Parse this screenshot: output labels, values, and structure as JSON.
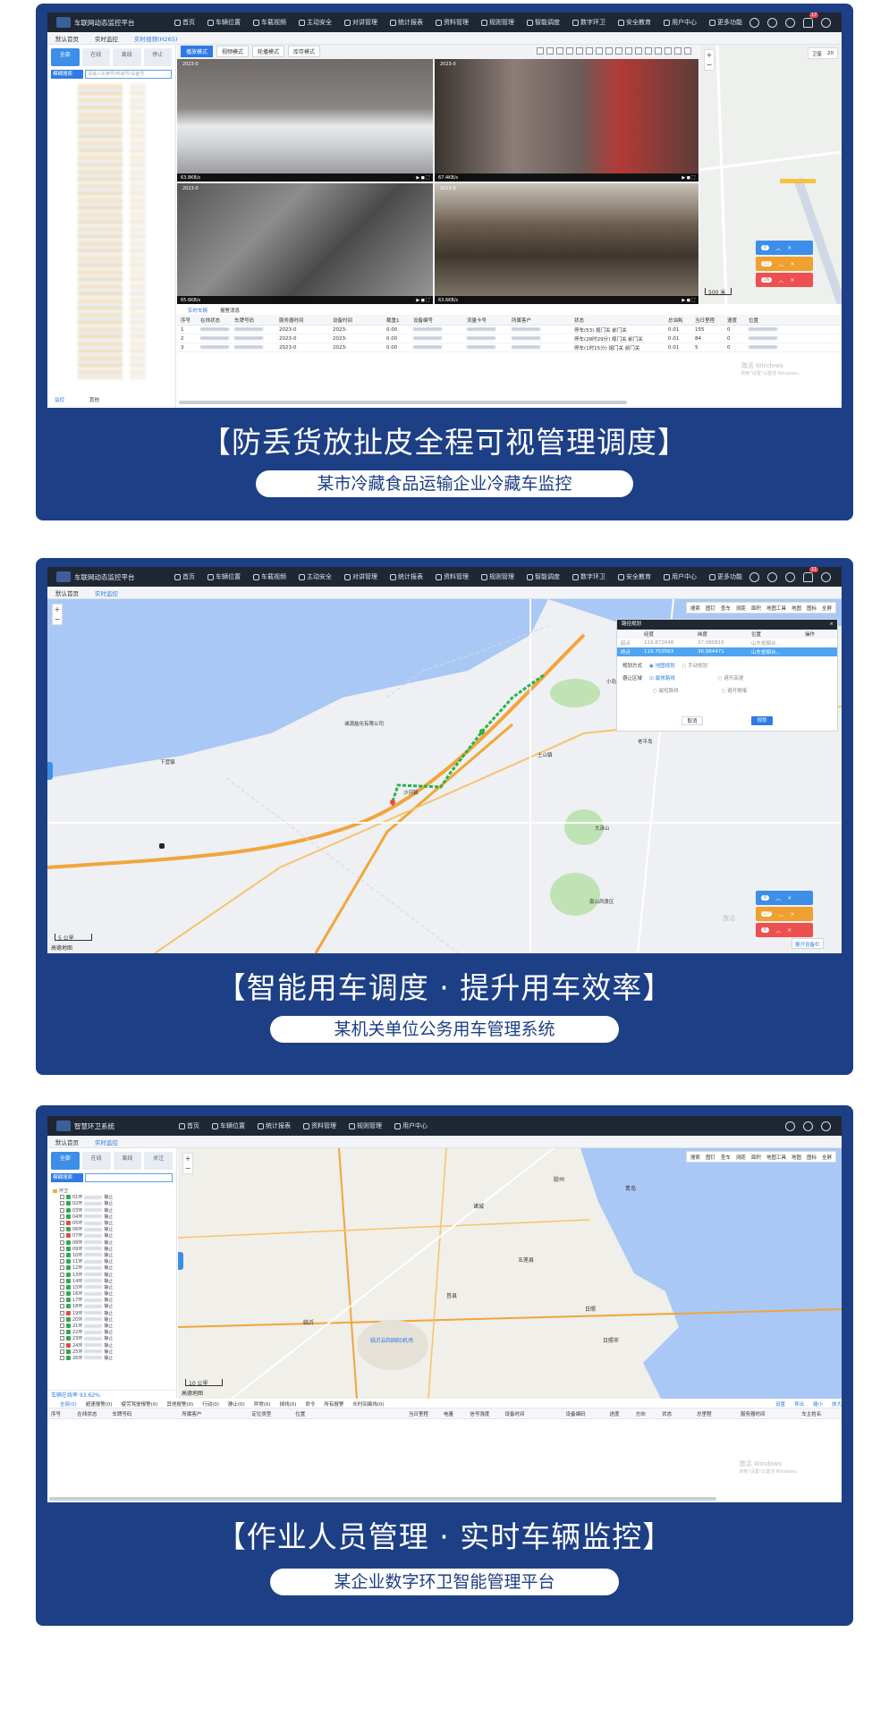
{
  "colors": {
    "card_bg": "#1d3f86",
    "app_bar": "#1f2733",
    "accent": "#2e7ae6",
    "track_green": "#28b44a",
    "road_orange": "#f3a53a",
    "sea_blue": "#a9c8f5"
  },
  "panel1": {
    "app_title": "车联网动态监控平台",
    "menu": [
      {
        "label": "首页",
        "icon": "home-icon"
      },
      {
        "label": "车辆位置",
        "icon": "vehicle-icon"
      },
      {
        "label": "车载视频",
        "icon": "camera-icon"
      },
      {
        "label": "主动安全",
        "icon": "shield-icon"
      },
      {
        "label": "对讲管理",
        "icon": "mic-icon"
      },
      {
        "label": "统计报表",
        "icon": "chart-icon"
      },
      {
        "label": "资料管理",
        "icon": "folder-icon"
      },
      {
        "label": "规则管理",
        "icon": "rule-icon"
      },
      {
        "label": "智能调度",
        "icon": "dispatch-icon"
      },
      {
        "label": "数字环卫",
        "icon": "sanitation-icon"
      },
      {
        "label": "安全教育",
        "icon": "education-icon"
      },
      {
        "label": "用户中心",
        "icon": "user-icon"
      },
      {
        "label": "更多功能",
        "icon": "grid-icon"
      }
    ],
    "bell_count": "17",
    "tabs": [
      "默认首页",
      "实时监控",
      "实时视频(H265)"
    ],
    "status_chips": [
      "全部",
      "在线",
      "离线",
      "停止"
    ],
    "search_select": "模糊搜索",
    "search_placeholder": "请输入车牌号/终端号/设备号",
    "video_modes": [
      "播放模式",
      "视频模式",
      "轮播模式",
      "库存模式"
    ],
    "videos": [
      {
        "speed": "63.8KB/s"
      },
      {
        "speed": "67.4KB/s"
      },
      {
        "speed": "65.6KB/s"
      },
      {
        "speed": "63.6KB/s"
      }
    ],
    "video_timestamp": "2023-0",
    "map_layer": "卫星",
    "map_zoom": "20",
    "map_scale": "500 米",
    "fab_counts": [
      "0",
      "12",
      "26"
    ],
    "list_tab": "实时车辆",
    "list_tab2": "报警消息",
    "table_headers": [
      "序号",
      "在线状态",
      "车牌号码",
      "服务器时间",
      "设备时间",
      "载重1",
      "设备编号",
      "流量卡号",
      "所属客户",
      "状态",
      "总油耗",
      "当日里程",
      "速度",
      "位置"
    ],
    "table_rows": [
      {
        "idx": "1",
        "server_time": "2023-0",
        "dev_time": "2023-",
        "load": "0.00",
        "status": "停车(53)  熄门关  前门关",
        "fuel": "0.01",
        "mileage": "155",
        "speed": "0"
      },
      {
        "idx": "2",
        "server_time": "2023-0",
        "dev_time": "2023-",
        "load": "0.00",
        "status": "停车(28时29分) 熄门关  前门关",
        "fuel": "0.01",
        "mileage": "84",
        "speed": "0"
      },
      {
        "idx": "3",
        "server_time": "2023-0",
        "dev_time": "2023-",
        "load": "0.00",
        "status": "停车(1时15分) 熄门关  前门关",
        "fuel": "0.01",
        "mileage": "5",
        "speed": "0"
      }
    ],
    "bottom_tabs": [
      "监控",
      "其他"
    ],
    "watermark_title": "激活 Windows",
    "watermark_sub": "转到\"设置\"以激活 Windows。",
    "caption": "【防丢货放扯皮全程可视管理调度】",
    "subcaption": "某市冷藏食品运输企业冷藏车监控"
  },
  "panel2": {
    "app_title": "车联网动态监控平台",
    "menu": [
      {
        "label": "首页",
        "icon": "home-icon"
      },
      {
        "label": "车辆位置",
        "icon": "vehicle-icon"
      },
      {
        "label": "车载视频",
        "icon": "camera-icon"
      },
      {
        "label": "主动安全",
        "icon": "shield-icon"
      },
      {
        "label": "对讲管理",
        "icon": "mic-icon"
      },
      {
        "label": "统计报表",
        "icon": "chart-icon"
      },
      {
        "label": "资料管理",
        "icon": "folder-icon"
      },
      {
        "label": "规则管理",
        "icon": "rule-icon"
      },
      {
        "label": "智能调度",
        "icon": "dispatch-icon"
      },
      {
        "label": "数字环卫",
        "icon": "sanitation-icon"
      },
      {
        "label": "安全教育",
        "icon": "education-icon"
      },
      {
        "label": "用户中心",
        "icon": "user-icon"
      },
      {
        "label": "更多功能",
        "icon": "grid-icon"
      }
    ],
    "bell_count": "11",
    "tabs": [
      "默认首页",
      "实时监控"
    ],
    "map_tools": [
      "搜索",
      "图钉",
      "查车",
      "测距",
      "面积",
      "地图工具",
      "地图",
      "图标",
      "全屏"
    ],
    "route_panel": {
      "title": "路径规划",
      "headers": [
        "",
        "经度",
        "纬度",
        "位置",
        "操作"
      ],
      "rows": [
        {
          "name": "起点",
          "lng": "119.872648",
          "lat": "37.080816",
          "pos": "山东省烟台..."
        },
        {
          "name": "终点",
          "lng": "119.753563",
          "lat": "36.984471",
          "pos": "山东省烟台..."
        }
      ],
      "mode_label": "规划方式",
      "mode_opts": [
        "地图规划",
        "手动规划"
      ],
      "avoid_label": "避让区域",
      "opts": [
        "最快路线",
        "避开高速",
        "最短路线",
        "避开拥堵"
      ],
      "cancel": "取消",
      "confirm": "规划"
    },
    "place_labels": [
      "诚源盐化有限公司",
      "老平岛",
      "大泽山",
      "小岛",
      "南山风景区",
      "沙河镇",
      "土山镇",
      "下营镇"
    ],
    "fab_counts": [
      "0",
      "27",
      "6"
    ],
    "watermark_title": "激活",
    "collapse_btn": "展开设备栏",
    "map_scale": "5 公里",
    "logo": "高德地图",
    "caption": "【智能用车调度 · 提升用车效率】",
    "subcaption": "某机关单位公务用车管理系统"
  },
  "panel3": {
    "app_title": "智慧环卫系统",
    "menu": [
      {
        "label": "首页",
        "icon": "home-icon"
      },
      {
        "label": "车辆位置",
        "icon": "vehicle-icon"
      },
      {
        "label": "统计报表",
        "icon": "chart-icon"
      },
      {
        "label": "资料管理",
        "icon": "folder-icon"
      },
      {
        "label": "规则管理",
        "icon": "rule-icon"
      },
      {
        "label": "用户中心",
        "icon": "user-icon"
      }
    ],
    "tabs": [
      "默认首页",
      "实时监控"
    ],
    "status_chips": [
      "全部",
      "在线",
      "离线",
      "关注"
    ],
    "search_select": "模糊搜索",
    "tree_root": "环卫",
    "tree_items": [
      "01环",
      "02环",
      "03环",
      "04环",
      "05环",
      "06环",
      "07环",
      "08环",
      "09环",
      "10环",
      "11环",
      "12环",
      "13环",
      "14环",
      "15环",
      "16环",
      "17环",
      "18环",
      "19环",
      "20环",
      "21环",
      "22环",
      "23环",
      "24环",
      "25环",
      "26环"
    ],
    "tree_state": "静止",
    "online_rate": "车辆在线率 93.62%",
    "map_tools": [
      "搜索",
      "图钉",
      "查车",
      "测距",
      "面积",
      "地图工具",
      "地图",
      "图标",
      "全屏"
    ],
    "city_labels": [
      "临沂",
      "日照",
      "青岛",
      "莒县",
      "五莲县",
      "诸城",
      "胶州",
      "日照市",
      "临沂启阳国际机场"
    ],
    "map_scale": "10 公里",
    "logo": "高德地图",
    "alarm_tabs": [
      "全部(0)",
      "超速报警(0)",
      "疲劳驾驶报警(0)",
      "其他报警(0)",
      "行动(0)",
      "静止(0)",
      "异常(0)",
      "掉线(0)",
      "命令",
      "所有报警",
      "长时间离线(0)"
    ],
    "alarm_actions": [
      "设置",
      "导出",
      "缩小",
      "放大"
    ],
    "table_headers": [
      "序号",
      "在线状态",
      "车牌号码",
      "所属客户",
      "定位类型",
      "位置",
      "当日里程",
      "电量",
      "信号强度",
      "设备时间",
      "设备编码",
      "进度",
      "方向",
      "状态",
      "总里程",
      "服务器时间",
      "车主姓名"
    ],
    "watermark_title": "激活 Windows",
    "watermark_sub": "转到\"设置\"以激活 Windows。",
    "caption": "【作业人员管理 · 实时车辆监控】",
    "subcaption": "某企业数字环卫智能管理平台"
  }
}
